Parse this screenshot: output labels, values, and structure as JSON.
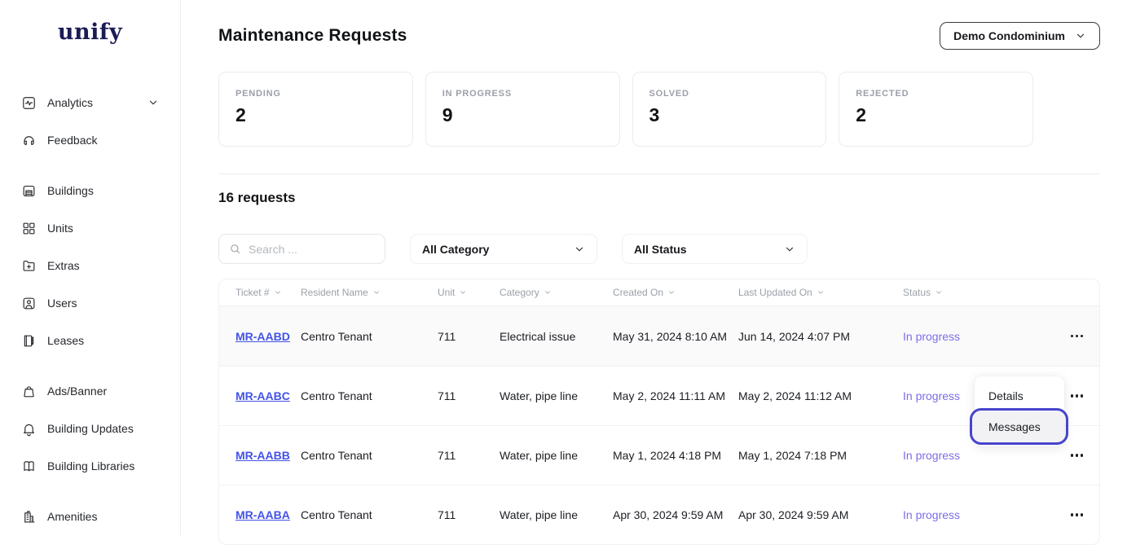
{
  "brand": {
    "logo_text": "unify"
  },
  "sidebar": {
    "groups": [
      {
        "items": [
          {
            "label": "Analytics",
            "icon": "analytics-icon",
            "has_chevron": true
          },
          {
            "label": "Feedback",
            "icon": "feedback-icon"
          }
        ]
      },
      {
        "items": [
          {
            "label": "Buildings",
            "icon": "buildings-icon"
          },
          {
            "label": "Units",
            "icon": "units-icon"
          },
          {
            "label": "Extras",
            "icon": "extras-icon"
          },
          {
            "label": "Users",
            "icon": "users-icon"
          },
          {
            "label": "Leases",
            "icon": "leases-icon"
          }
        ]
      },
      {
        "items": [
          {
            "label": "Ads/Banner",
            "icon": "ads-banner-icon"
          },
          {
            "label": "Building Updates",
            "icon": "bell-icon"
          },
          {
            "label": "Building Libraries",
            "icon": "book-icon"
          }
        ]
      },
      {
        "items": [
          {
            "label": "Amenities",
            "icon": "amenities-icon"
          }
        ]
      }
    ]
  },
  "header": {
    "title": "Maintenance Requests",
    "building_selector": {
      "label": "Demo Condominium"
    }
  },
  "stats": [
    {
      "label": "PENDING",
      "value": "2"
    },
    {
      "label": "IN PROGRESS",
      "value": "9"
    },
    {
      "label": "SOLVED",
      "value": "3"
    },
    {
      "label": "REJECTED",
      "value": "2"
    }
  ],
  "requests": {
    "count_label": "16 requests",
    "search_placeholder": "Search ...",
    "filters": [
      {
        "label": "All Category"
      },
      {
        "label": "All Status"
      }
    ],
    "table": {
      "columns": [
        "Ticket #",
        "Resident Name",
        "Unit",
        "Category",
        "Created On",
        "Last Updated On",
        "Status"
      ],
      "rows": [
        {
          "ticket": "MR-AABD",
          "resident": "Centro Tenant",
          "unit": "711",
          "category": "Electrical issue",
          "created": "May 31, 2024 8:10 AM",
          "updated": "Jun 14, 2024 4:07 PM",
          "status": "In progress"
        },
        {
          "ticket": "MR-AABC",
          "resident": "Centro Tenant",
          "unit": "711",
          "category": "Water, pipe line",
          "created": "May 2, 2024 11:11 AM",
          "updated": "May 2, 2024 11:12 AM",
          "status": "In progress"
        },
        {
          "ticket": "MR-AABB",
          "resident": "Centro Tenant",
          "unit": "711",
          "category": "Water, pipe line",
          "created": "May 1, 2024 4:18 PM",
          "updated": "May 1, 2024 7:18 PM",
          "status": "In progress"
        },
        {
          "ticket": "MR-AABA",
          "resident": "Centro Tenant",
          "unit": "711",
          "category": "Water, pipe line",
          "created": "Apr 30, 2024 9:59 AM",
          "updated": "Apr 30, 2024 9:59 AM",
          "status": "In progress"
        }
      ]
    }
  },
  "context_menu": {
    "items": [
      {
        "label": "Details",
        "highlighted": false
      },
      {
        "label": "Messages",
        "highlighted": true
      }
    ]
  },
  "colors": {
    "logo_navy": "#1b1c55",
    "link_blue": "#4353e6",
    "status_purple": "#7c6ee8",
    "annotation_indigo": "#4744cc",
    "muted_gray": "#9ba0a8",
    "border_gray": "#f1f1f3"
  }
}
